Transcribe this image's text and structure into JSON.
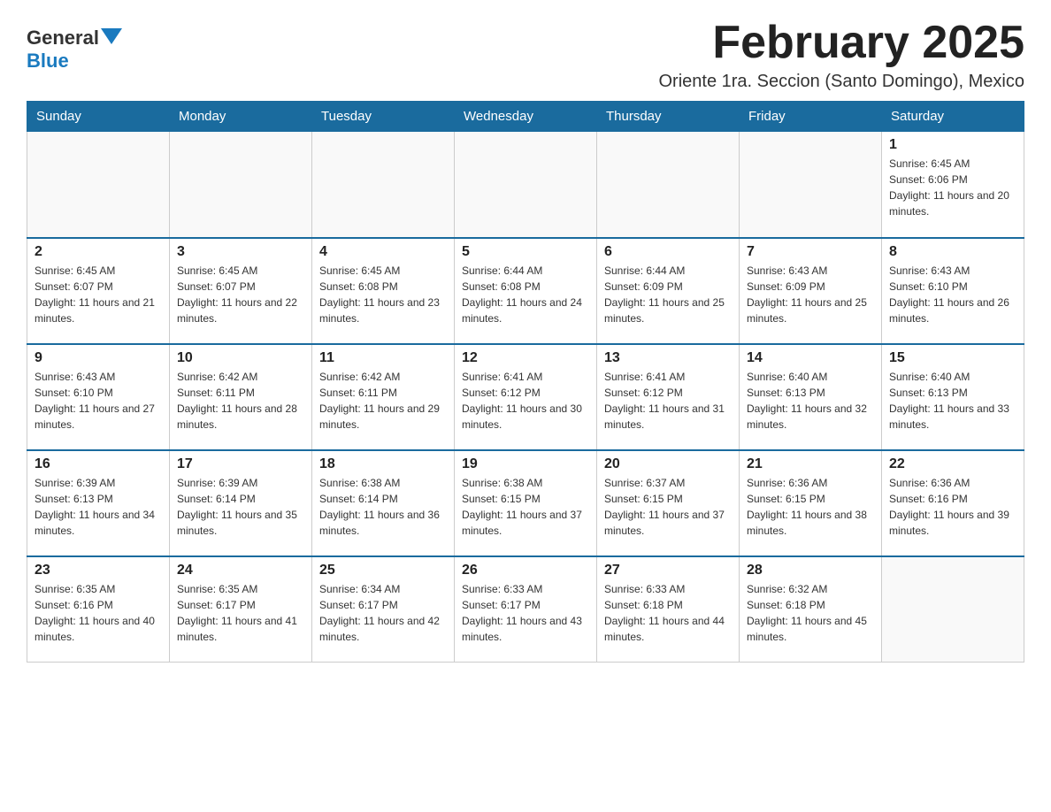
{
  "header": {
    "logo_general": "General",
    "logo_blue": "Blue",
    "month_title": "February 2025",
    "subtitle": "Oriente 1ra. Seccion (Santo Domingo), Mexico"
  },
  "days_of_week": [
    "Sunday",
    "Monday",
    "Tuesday",
    "Wednesday",
    "Thursday",
    "Friday",
    "Saturday"
  ],
  "weeks": [
    [
      {
        "day": "",
        "info": ""
      },
      {
        "day": "",
        "info": ""
      },
      {
        "day": "",
        "info": ""
      },
      {
        "day": "",
        "info": ""
      },
      {
        "day": "",
        "info": ""
      },
      {
        "day": "",
        "info": ""
      },
      {
        "day": "1",
        "info": "Sunrise: 6:45 AM\nSunset: 6:06 PM\nDaylight: 11 hours and 20 minutes."
      }
    ],
    [
      {
        "day": "2",
        "info": "Sunrise: 6:45 AM\nSunset: 6:07 PM\nDaylight: 11 hours and 21 minutes."
      },
      {
        "day": "3",
        "info": "Sunrise: 6:45 AM\nSunset: 6:07 PM\nDaylight: 11 hours and 22 minutes."
      },
      {
        "day": "4",
        "info": "Sunrise: 6:45 AM\nSunset: 6:08 PM\nDaylight: 11 hours and 23 minutes."
      },
      {
        "day": "5",
        "info": "Sunrise: 6:44 AM\nSunset: 6:08 PM\nDaylight: 11 hours and 24 minutes."
      },
      {
        "day": "6",
        "info": "Sunrise: 6:44 AM\nSunset: 6:09 PM\nDaylight: 11 hours and 25 minutes."
      },
      {
        "day": "7",
        "info": "Sunrise: 6:43 AM\nSunset: 6:09 PM\nDaylight: 11 hours and 25 minutes."
      },
      {
        "day": "8",
        "info": "Sunrise: 6:43 AM\nSunset: 6:10 PM\nDaylight: 11 hours and 26 minutes."
      }
    ],
    [
      {
        "day": "9",
        "info": "Sunrise: 6:43 AM\nSunset: 6:10 PM\nDaylight: 11 hours and 27 minutes."
      },
      {
        "day": "10",
        "info": "Sunrise: 6:42 AM\nSunset: 6:11 PM\nDaylight: 11 hours and 28 minutes."
      },
      {
        "day": "11",
        "info": "Sunrise: 6:42 AM\nSunset: 6:11 PM\nDaylight: 11 hours and 29 minutes."
      },
      {
        "day": "12",
        "info": "Sunrise: 6:41 AM\nSunset: 6:12 PM\nDaylight: 11 hours and 30 minutes."
      },
      {
        "day": "13",
        "info": "Sunrise: 6:41 AM\nSunset: 6:12 PM\nDaylight: 11 hours and 31 minutes."
      },
      {
        "day": "14",
        "info": "Sunrise: 6:40 AM\nSunset: 6:13 PM\nDaylight: 11 hours and 32 minutes."
      },
      {
        "day": "15",
        "info": "Sunrise: 6:40 AM\nSunset: 6:13 PM\nDaylight: 11 hours and 33 minutes."
      }
    ],
    [
      {
        "day": "16",
        "info": "Sunrise: 6:39 AM\nSunset: 6:13 PM\nDaylight: 11 hours and 34 minutes."
      },
      {
        "day": "17",
        "info": "Sunrise: 6:39 AM\nSunset: 6:14 PM\nDaylight: 11 hours and 35 minutes."
      },
      {
        "day": "18",
        "info": "Sunrise: 6:38 AM\nSunset: 6:14 PM\nDaylight: 11 hours and 36 minutes."
      },
      {
        "day": "19",
        "info": "Sunrise: 6:38 AM\nSunset: 6:15 PM\nDaylight: 11 hours and 37 minutes."
      },
      {
        "day": "20",
        "info": "Sunrise: 6:37 AM\nSunset: 6:15 PM\nDaylight: 11 hours and 37 minutes."
      },
      {
        "day": "21",
        "info": "Sunrise: 6:36 AM\nSunset: 6:15 PM\nDaylight: 11 hours and 38 minutes."
      },
      {
        "day": "22",
        "info": "Sunrise: 6:36 AM\nSunset: 6:16 PM\nDaylight: 11 hours and 39 minutes."
      }
    ],
    [
      {
        "day": "23",
        "info": "Sunrise: 6:35 AM\nSunset: 6:16 PM\nDaylight: 11 hours and 40 minutes."
      },
      {
        "day": "24",
        "info": "Sunrise: 6:35 AM\nSunset: 6:17 PM\nDaylight: 11 hours and 41 minutes."
      },
      {
        "day": "25",
        "info": "Sunrise: 6:34 AM\nSunset: 6:17 PM\nDaylight: 11 hours and 42 minutes."
      },
      {
        "day": "26",
        "info": "Sunrise: 6:33 AM\nSunset: 6:17 PM\nDaylight: 11 hours and 43 minutes."
      },
      {
        "day": "27",
        "info": "Sunrise: 6:33 AM\nSunset: 6:18 PM\nDaylight: 11 hours and 44 minutes."
      },
      {
        "day": "28",
        "info": "Sunrise: 6:32 AM\nSunset: 6:18 PM\nDaylight: 11 hours and 45 minutes."
      },
      {
        "day": "",
        "info": ""
      }
    ]
  ]
}
